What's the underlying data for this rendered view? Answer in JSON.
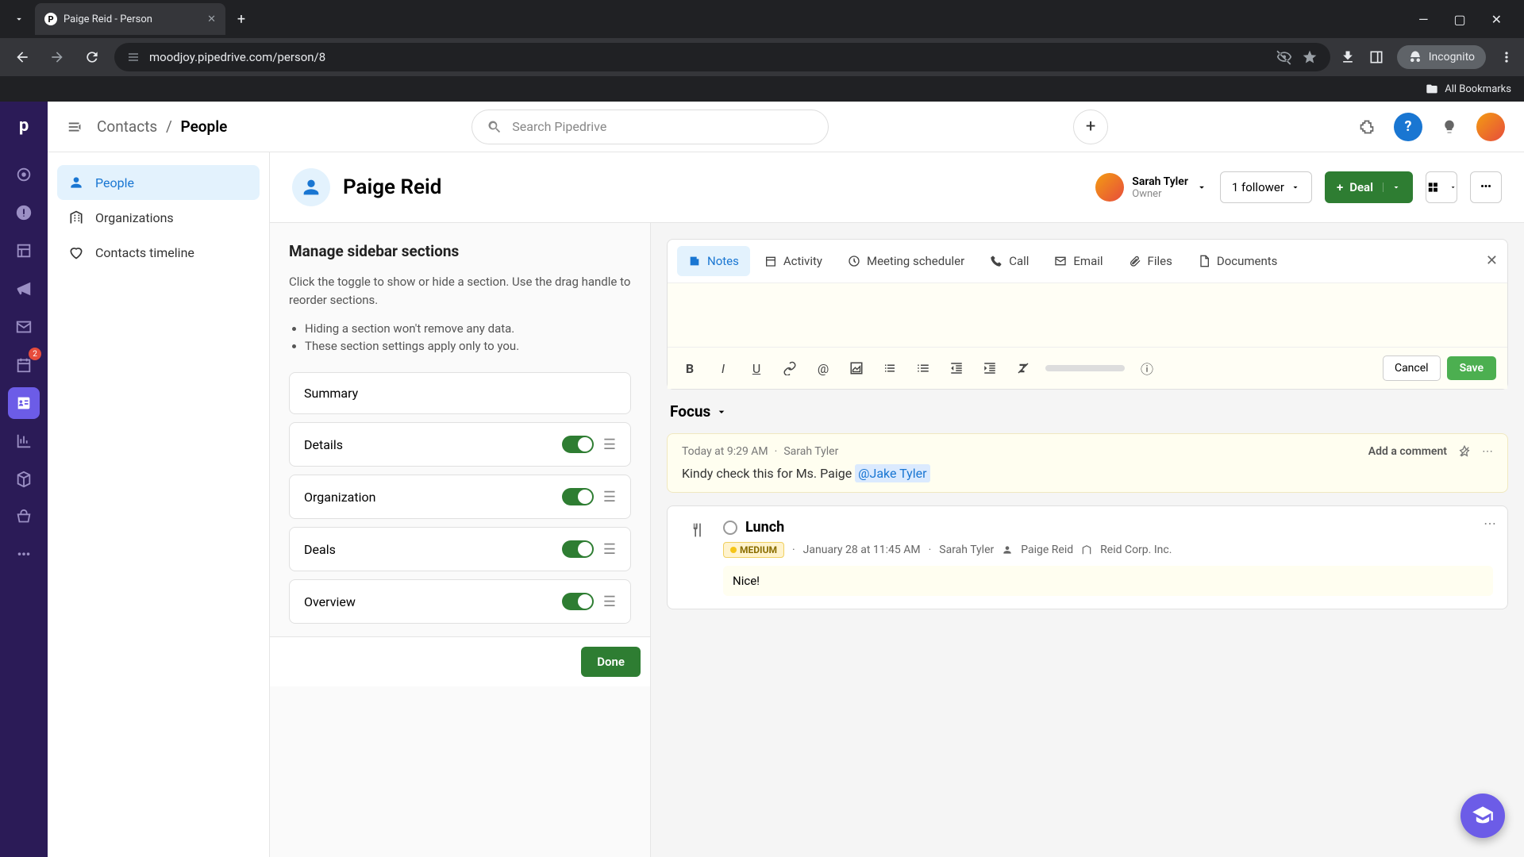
{
  "browser": {
    "tab_title": "Paige Reid - Person",
    "url": "moodjoy.pipedrive.com/person/8",
    "incognito": "Incognito",
    "bookmarks": "All Bookmarks"
  },
  "topbar": {
    "breadcrumb_root": "Contacts",
    "breadcrumb_current": "People",
    "search_placeholder": "Search Pipedrive"
  },
  "sub_sidebar": {
    "items": [
      {
        "label": "People"
      },
      {
        "label": "Organizations"
      },
      {
        "label": "Contacts timeline"
      }
    ]
  },
  "rail_badge": "2",
  "person": {
    "name": "Paige Reid",
    "owner_name": "Sarah Tyler",
    "owner_role": "Owner",
    "followers": "1 follower",
    "deal_label": "Deal"
  },
  "manage": {
    "title": "Manage sidebar sections",
    "desc": "Click the toggle to show or hide a section. Use the drag handle to reorder sections.",
    "bullet1": "Hiding a section won't remove any data.",
    "bullet2": "These section settings apply only to you.",
    "sections": [
      {
        "label": "Summary"
      },
      {
        "label": "Details"
      },
      {
        "label": "Organization"
      },
      {
        "label": "Deals"
      },
      {
        "label": "Overview"
      }
    ],
    "done": "Done"
  },
  "notes": {
    "tabs": {
      "notes": "Notes",
      "activity": "Activity",
      "meeting": "Meeting scheduler",
      "call": "Call",
      "email": "Email",
      "files": "Files",
      "documents": "Documents"
    },
    "cancel": "Cancel",
    "save": "Save"
  },
  "focus": {
    "label": "Focus"
  },
  "feed_note": {
    "time": "Today at 9:29 AM",
    "author": "Sarah Tyler",
    "add_comment": "Add a comment",
    "text": "Kindy check this for Ms. Paige ",
    "mention": "@Jake Tyler"
  },
  "activity": {
    "title": "Lunch",
    "priority": "MEDIUM",
    "datetime": "January 28 at 11:45 AM",
    "author": "Sarah Tyler",
    "person": "Paige Reid",
    "org": "Reid Corp. Inc.",
    "note": "Nice!"
  }
}
